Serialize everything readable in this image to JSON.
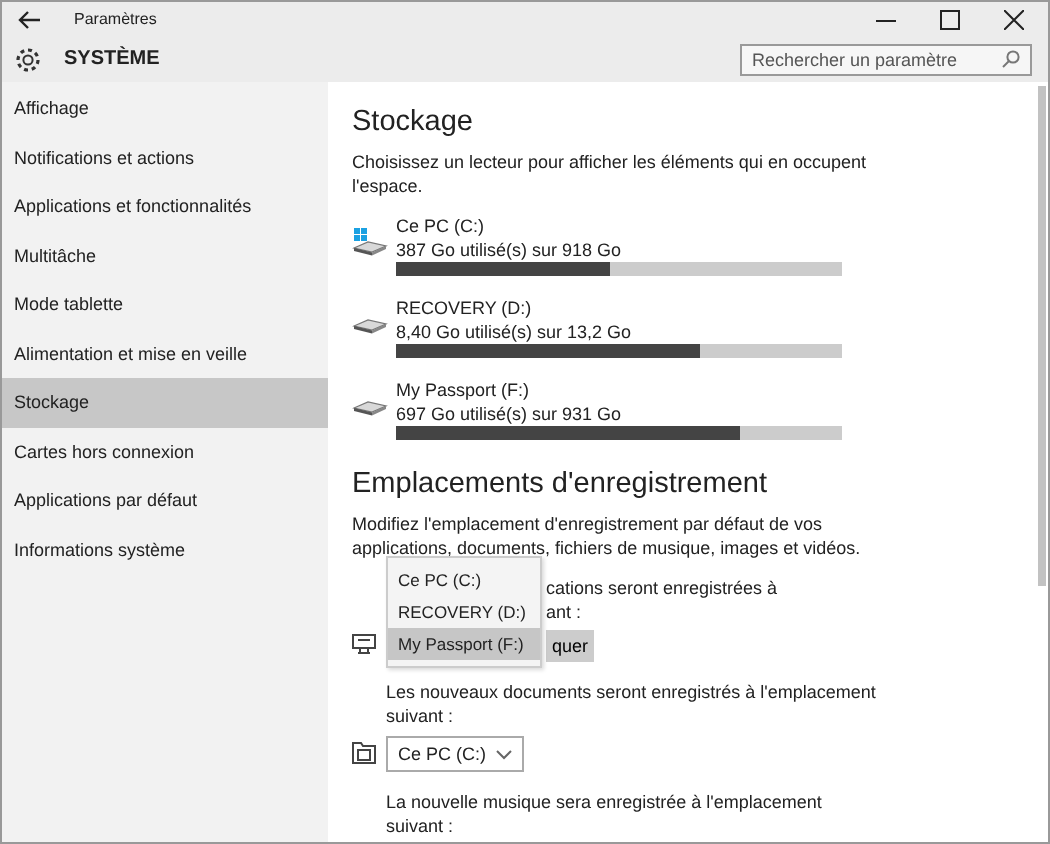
{
  "window": {
    "title": "Paramètres"
  },
  "header": {
    "title": "SYSTÈME",
    "search": {
      "placeholder": "Rechercher un paramètre"
    }
  },
  "sidebar": {
    "items": [
      {
        "label": "Affichage",
        "selected": false
      },
      {
        "label": "Notifications et actions",
        "selected": false
      },
      {
        "label": "Applications et fonctionnalités",
        "selected": false
      },
      {
        "label": "Multitâche",
        "selected": false
      },
      {
        "label": "Mode tablette",
        "selected": false
      },
      {
        "label": "Alimentation et mise en veille",
        "selected": false
      },
      {
        "label": "Stockage",
        "selected": true
      },
      {
        "label": "Cartes hors connexion",
        "selected": false
      },
      {
        "label": "Applications par défaut",
        "selected": false
      },
      {
        "label": "Informations système",
        "selected": false
      }
    ]
  },
  "storage": {
    "title": "Stockage",
    "description": "Choisissez un lecteur pour afficher les éléments qui en occupent l'espace.",
    "drives": [
      {
        "kind": "system",
        "name": "Ce PC (C:)",
        "usage": "387 Go utilisé(s) sur 918 Go",
        "level": 0.48
      },
      {
        "kind": "external",
        "name": "RECOVERY (D:)",
        "usage": "8,40 Go utilisé(s) sur 13,2 Go",
        "level": 0.68
      },
      {
        "kind": "external",
        "name": "My Passport (F:)",
        "usage": "697 Go utilisé(s) sur 931 Go",
        "level": 0.77
      }
    ]
  },
  "save_locations": {
    "title": "Emplacements d'enregistrement",
    "description": "Modifiez l'emplacement d'enregistrement par défaut de vos applications, documents, fichiers de musique, images et vidéos.",
    "groups": [
      {
        "kind": "apps",
        "label_lines": [
          "cations seront enregistrées à",
          "ant :"
        ],
        "button": "quer",
        "menu": [
          {
            "label": "Ce PC (C:)",
            "selected": false
          },
          {
            "label": "RECOVERY (D:)",
            "selected": false
          },
          {
            "label": "My Passport (F:)",
            "selected": true
          }
        ]
      },
      {
        "kind": "documents",
        "label_lines": [
          "Les nouveaux documents seront enregistrés à l'emplacement",
          "suivant :"
        ],
        "select": "Ce PC (C:)"
      },
      {
        "kind": "music",
        "label_lines": [
          "La nouvelle musique sera enregistrée à l'emplacement",
          "suivant :"
        ]
      }
    ]
  }
}
